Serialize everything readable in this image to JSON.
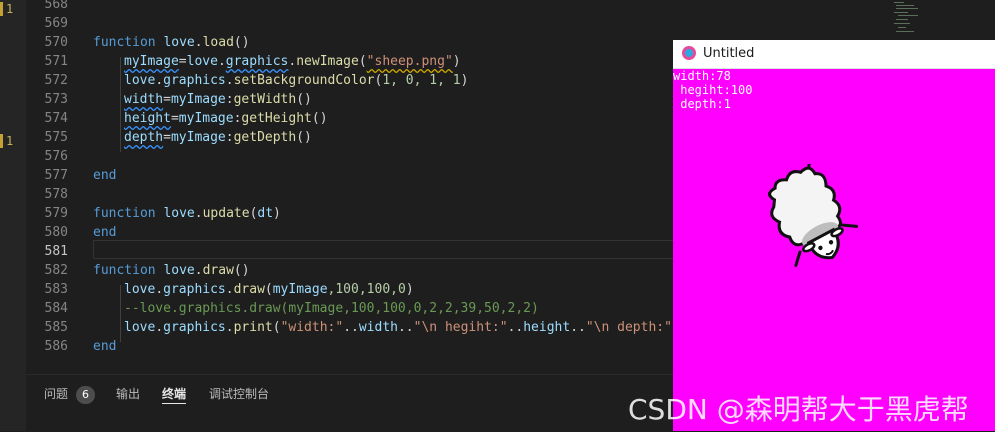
{
  "gutter": {
    "marker_label": "1"
  },
  "editor": {
    "lines": [
      {
        "n": "568"
      },
      {
        "n": "569"
      },
      {
        "n": "570"
      },
      {
        "n": "571"
      },
      {
        "n": "572"
      },
      {
        "n": "573"
      },
      {
        "n": "574"
      },
      {
        "n": "575"
      },
      {
        "n": "576"
      },
      {
        "n": "577"
      },
      {
        "n": "578"
      },
      {
        "n": "579"
      },
      {
        "n": "580"
      },
      {
        "n": "581"
      },
      {
        "n": "582"
      },
      {
        "n": "583"
      },
      {
        "n": "584"
      },
      {
        "n": "585"
      },
      {
        "n": "586"
      }
    ],
    "tokens": {
      "function": "function",
      "end": "end",
      "love": "love",
      "graphics": "graphics",
      "load": "load",
      "update": "update",
      "draw_fn": "draw",
      "newImage": "newImage",
      "setBackgroundColor": "setBackgroundColor",
      "draw": "draw",
      "print": "print",
      "getWidth": "getWidth",
      "getHeight": "getHeight",
      "getDepth": "getDepth",
      "myImage": "myImage",
      "width": "width",
      "height": "height",
      "depth": "depth",
      "dt": "dt",
      "sheep_str": "\"sheep.png\"",
      "bg_args": "1, 0, 1, 1",
      "draw_args_rest": ",100,100,0",
      "comment_584": "--love.graphics.draw(myImage,100,100,0,2,2,39,50,2,2)",
      "str_width": "\"width:\"",
      "str_hegiht": "\"\\n hegiht:\"",
      "str_depth": "\"\\n depth:\"",
      "concat": "..",
      "tail_585": ".."
    }
  },
  "panel": {
    "tabs": [
      {
        "label": "问题",
        "badge": "6"
      },
      {
        "label": "输出"
      },
      {
        "label": "终端"
      },
      {
        "label": "调试控制台"
      }
    ]
  },
  "love_window": {
    "title": "Untitled",
    "print_output": "width:78\n hegiht:100\n depth:1",
    "canvas_color": "#ff00ff"
  },
  "watermark": "CSDN @森明帮大于黑虎帮",
  "colors": {
    "keyword": "#569cd6",
    "function": "#dcdcaa",
    "variable": "#9cdcfe",
    "number": "#b5cea8",
    "string": "#ce9178",
    "comment": "#6a9955",
    "editor_bg": "#1e1e1e"
  }
}
